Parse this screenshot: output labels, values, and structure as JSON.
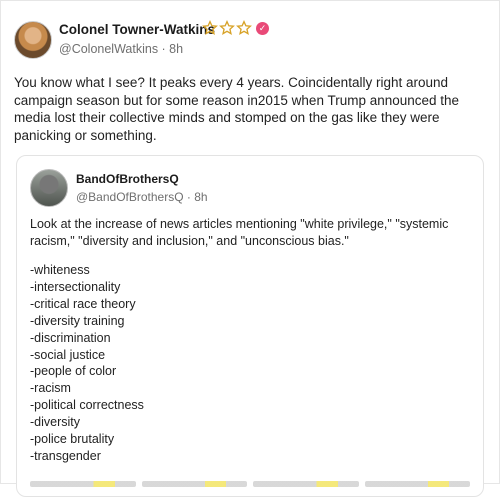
{
  "post": {
    "author_name": "Colonel Towner-Watkins",
    "handle_time": "@ColonelWatkins · 8h",
    "text": "You know what I see? It peaks every 4 years. Coincidentally right around campaign season but for some reason in2015 when Trump announced the media lost their collective minds and stomped on the gas like they were panicking or something.",
    "badges": [
      "star-icon",
      "star-icon",
      "star-icon",
      "verified-icon"
    ],
    "badge_colors": {
      "star": "#d8a329",
      "verified": "#e94a78"
    }
  },
  "quote": {
    "author_name": "BandOfBrothersQ",
    "handle_time": "@BandOfBrothersQ · 8h",
    "intro": "Look at the increase of news articles mentioning \"white privilege,\" \"systemic racism,\" \"diversity and inclusion,\" and \"unconscious bias.\"",
    "terms": [
      "-whiteness",
      "-intersectionality",
      "-critical race theory",
      "-diversity training",
      "-discrimination",
      "-social justice",
      "-people of color",
      "-racism",
      "-political correctness",
      "-diversity",
      "-police brutality",
      "-transgender"
    ]
  }
}
